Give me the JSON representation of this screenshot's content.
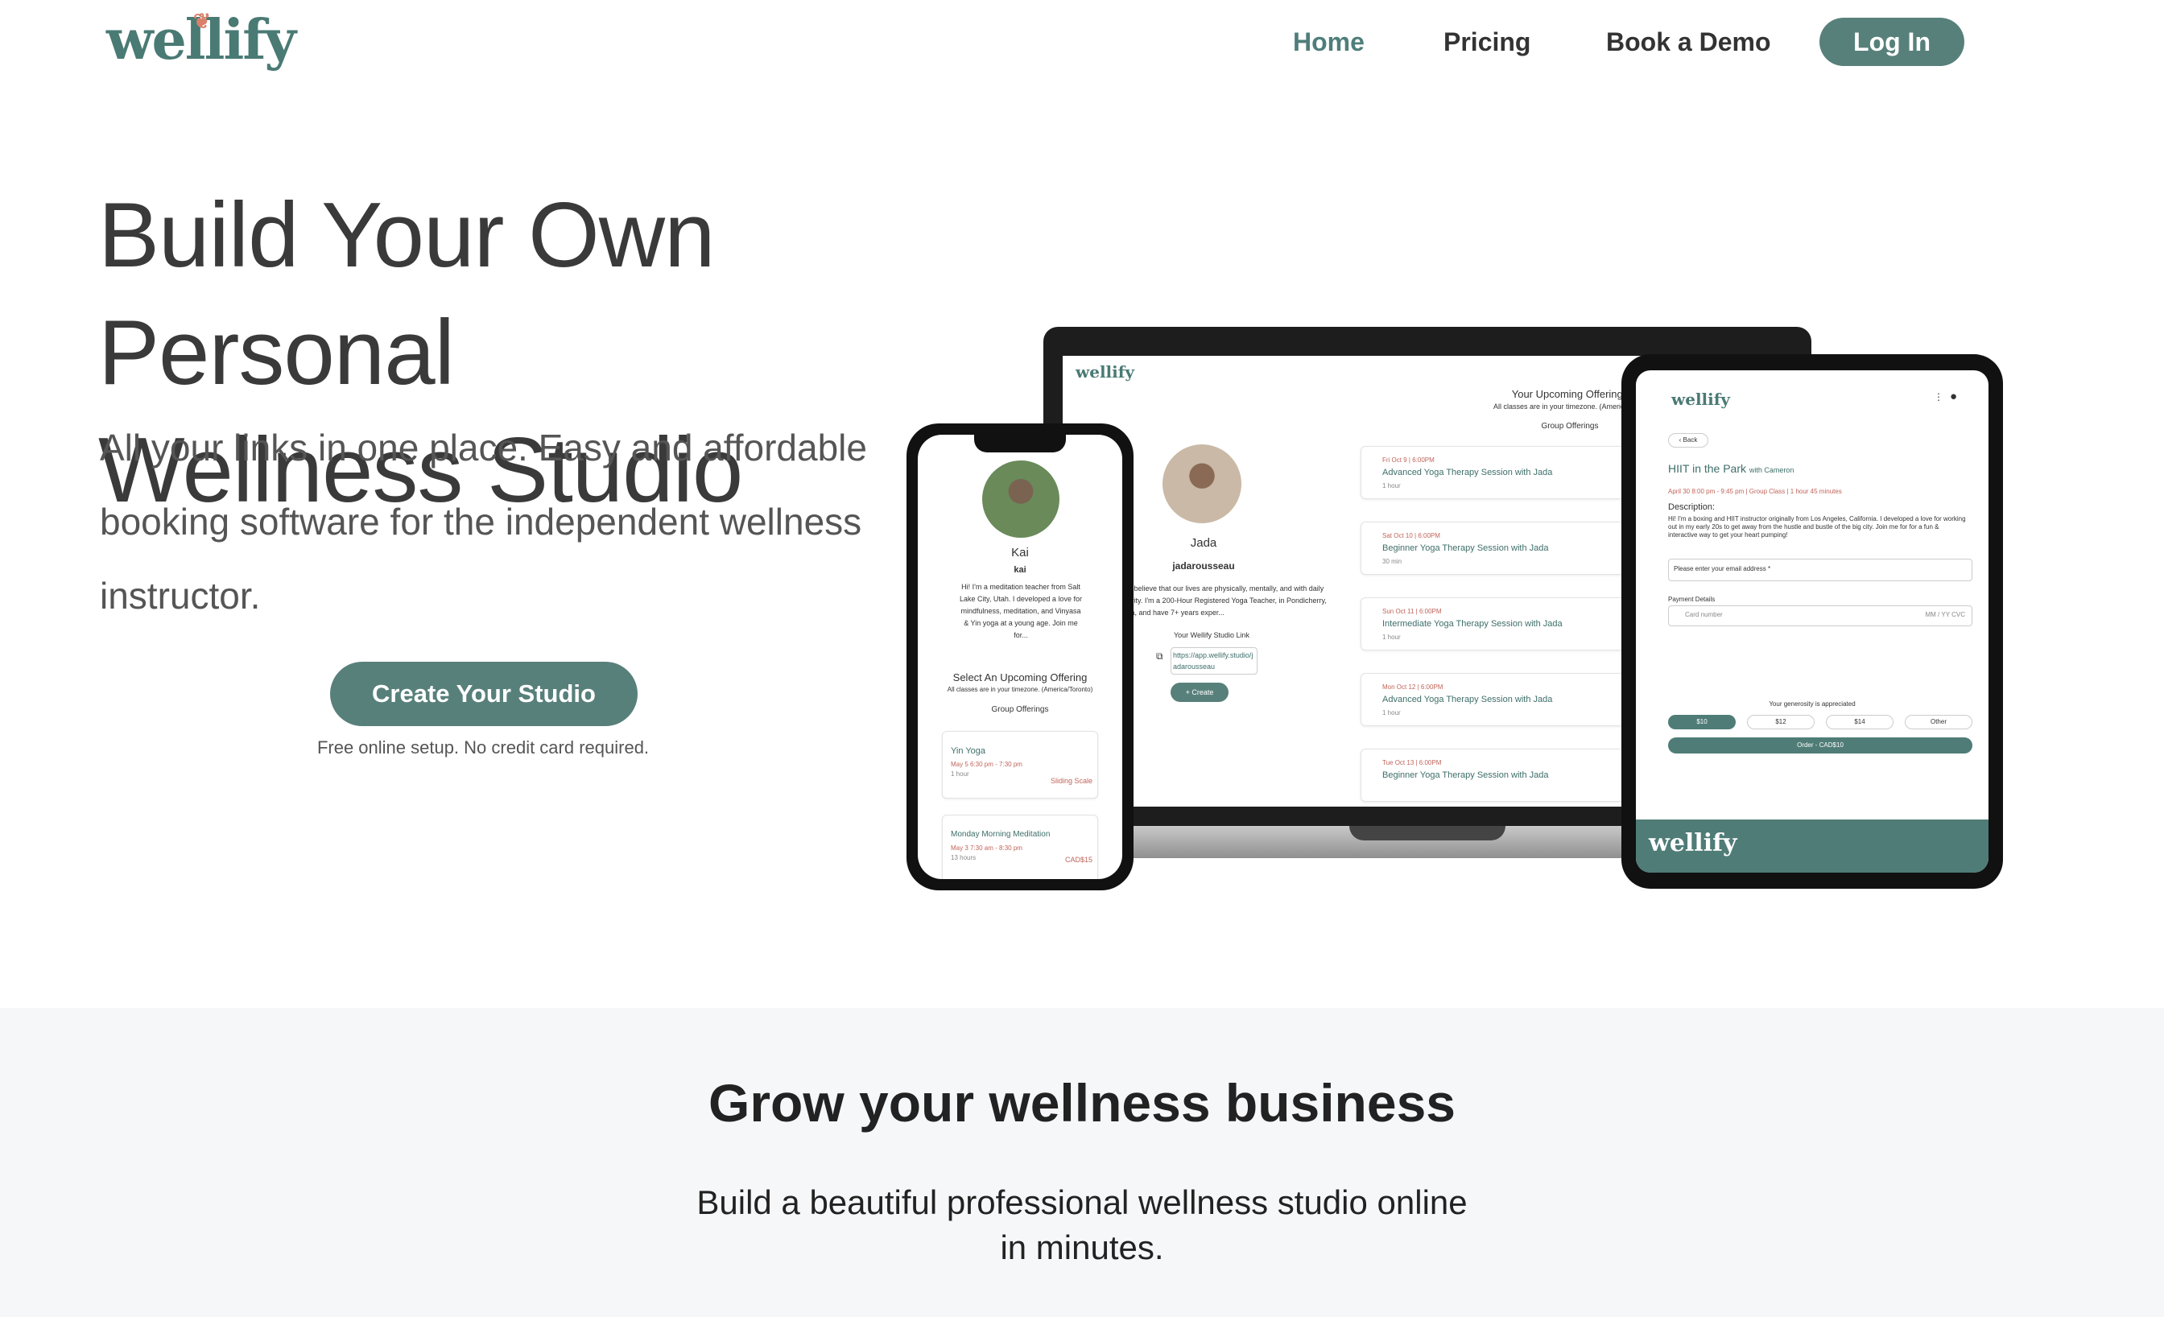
{
  "nav": {
    "logo": "wellify",
    "links": [
      {
        "label": "Home",
        "active": true
      },
      {
        "label": "Pricing",
        "active": false
      },
      {
        "label": "Book a Demo",
        "active": false
      }
    ],
    "login_label": "Log In"
  },
  "hero": {
    "title_line1": "Build Your Own Personal",
    "title_line2": "Wellness Studio",
    "subtitle": "All your links in one place. Easy and affordable booking software for the independent wellness instructor.",
    "cta_label": "Create Your Studio",
    "cta_note": "Free online setup. No credit card required."
  },
  "mockups": {
    "phone": {
      "name": "Kai",
      "handle": "kai",
      "bio": "Hi! I'm a meditation teacher from Salt Lake City, Utah. I developed a love for mindfulness, meditation, and Vinyasa & Yin yoga at a young age. Join me for...",
      "section_title": "Select An Upcoming Offering",
      "tz_note": "All classes are in your timezone. (America/Toronto)",
      "group_label": "Group Offerings",
      "offerings": [
        {
          "title": "Yin Yoga",
          "time": "May 5 6:30 pm - 7:30 pm",
          "dur": "1 hour",
          "price": "Sliding Scale"
        },
        {
          "title": "Monday Morning Meditation",
          "time": "May 3 7:30 am - 8:30 pm",
          "dur": "13 hours",
          "price": "CAD$15"
        }
      ]
    },
    "laptop": {
      "logo": "wellify",
      "name": "Jada",
      "handle": "jadarousseau",
      "bio": "Hi! I believe that our lives are physically, mentally, and with daily activity. I'm a 200-Hour Registered Yoga Teacher, in Pondicherry, India, and have 7+ years exper...",
      "link_label": "Your Wellify Studio Link",
      "link": "https://app.wellify.studio/jadarousseau",
      "create_label": "+ Create",
      "section_title": "Your Upcoming Offerings",
      "tz_note": "All classes are in your timezone. (America/",
      "group_label": "Group Offerings",
      "sessions": [
        {
          "date": "Fri Oct 9 | 6:00PM",
          "title": "Advanced Yoga Therapy Session with Jada",
          "dur": "1 hour"
        },
        {
          "date": "Sat Oct 10 | 6:00PM",
          "title": "Beginner Yoga Therapy Session with Jada",
          "dur": "30 min"
        },
        {
          "date": "Sun Oct 11 | 6:00PM",
          "title": "Intermediate Yoga Therapy Session with Jada",
          "dur": "1 hour"
        },
        {
          "date": "Mon Oct 12 | 6:00PM",
          "title": "Advanced Yoga Therapy Session with Jada",
          "dur": "1 hour"
        },
        {
          "date": "Tue Oct 13 | 6:00PM",
          "title": "Beginner Yoga Therapy Session with Jada",
          "dur": ""
        }
      ]
    },
    "tablet": {
      "logo": "wellify",
      "back": "Back",
      "event_title": "HIIT in the Park",
      "event_with": "with Cameron",
      "meta": "April 30 8:00 pm - 9:45 pm | Group Class | 1 hour 45 minutes",
      "desc_label": "Description:",
      "desc": "Hi! I'm a boxing and HIIT instructor originally from Los Angeles, California. I developed a love for working out in my early 20s to get away from the hustle and bustle of the big city. Join me for for a fun & interactive way to get your heart pumping!",
      "email_placeholder": "Please enter your email address *",
      "payment_label": "Payment Details",
      "card_placeholder": "Card number",
      "card_exp": "MM / YY  CVC",
      "generosity": "Your generosity is appreciated",
      "amounts": [
        "$10",
        "$12",
        "$14",
        "Other"
      ],
      "order_label": "Order - CAD$10",
      "footer_logo": "wellify"
    }
  },
  "section2": {
    "title": "Grow your wellness business",
    "subtitle": "Build a beautiful professional wellness studio online in minutes."
  },
  "colors": {
    "brand": "#58807b",
    "brand_dark": "#4f7c77",
    "accent_red": "#c0645a"
  }
}
